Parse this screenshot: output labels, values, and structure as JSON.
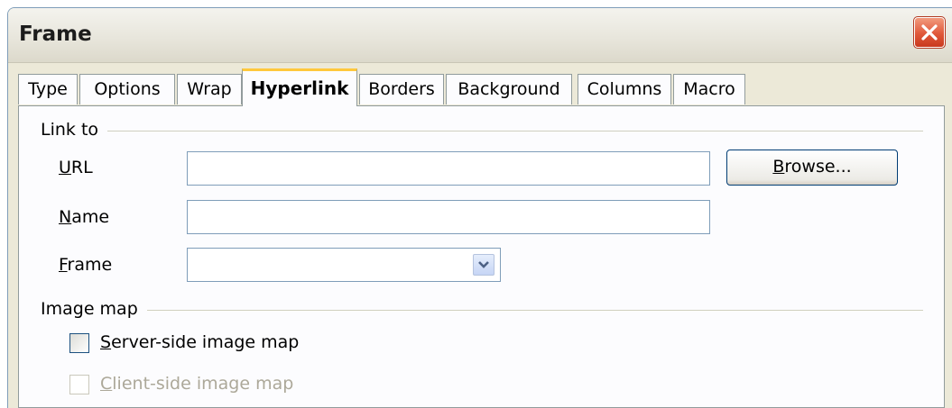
{
  "window": {
    "title": "Frame",
    "close_icon": "close-icon"
  },
  "tabs": [
    {
      "label": "Type",
      "active": false
    },
    {
      "label": "Options",
      "active": false
    },
    {
      "label": "Wrap",
      "active": false
    },
    {
      "label": "Hyperlink",
      "active": true
    },
    {
      "label": "Borders",
      "active": false
    },
    {
      "label": "Background",
      "active": false
    },
    {
      "label": "Columns",
      "active": false
    },
    {
      "label": "Macro",
      "active": false
    }
  ],
  "link_to": {
    "group_label": "Link to",
    "url": {
      "mnemonic": "U",
      "rest": "RL",
      "value": ""
    },
    "name": {
      "mnemonic": "N",
      "rest": "ame",
      "value": ""
    },
    "frame": {
      "mnemonic": "F",
      "rest": "rame",
      "value": ""
    },
    "browse": {
      "mnemonic": "B",
      "rest": "rowse..."
    }
  },
  "image_map": {
    "group_label": "Image map",
    "server_side": {
      "mnemonic": "S",
      "rest": "erver-side image map",
      "checked": false,
      "enabled": true
    },
    "client_side": {
      "mnemonic": "C",
      "rest": "lient-side image map",
      "checked": false,
      "enabled": false
    }
  },
  "colors": {
    "tab_highlight": "#ffc83c",
    "close_button": "#e0583a"
  }
}
